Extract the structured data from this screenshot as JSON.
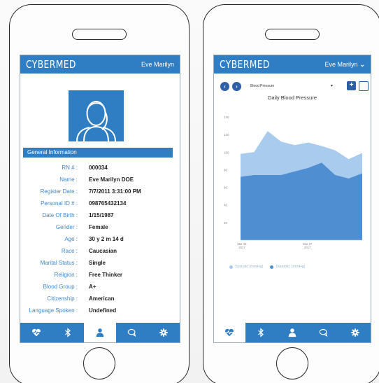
{
  "left_screen": {
    "app_title": "CYBERMED",
    "user_name": "Eve Marilyn",
    "section_title": "General Information",
    "rows": [
      {
        "label": "RN # :",
        "value": "000034"
      },
      {
        "label": "Name :",
        "value": "Eve Marilyn DOE"
      },
      {
        "label": "Register Date :",
        "value": "7/7/2011  3:31:00 PM"
      },
      {
        "label": "Personal ID # :",
        "value": "098765432134"
      },
      {
        "label": "Date Of Birth :",
        "value": "1/15/1987"
      },
      {
        "label": "Gender :",
        "value": "Female"
      },
      {
        "label": "Age :",
        "value": "30 y 2 m 14 d"
      },
      {
        "label": "Race :",
        "value": "Caucasian"
      },
      {
        "label": "Marital Status :",
        "value": "Single"
      },
      {
        "label": "Religion :",
        "value": "Free Thinker"
      },
      {
        "label": "Blood Group :",
        "value": "A+"
      },
      {
        "label": "Citizenship :",
        "value": "American"
      },
      {
        "label": "Language Spoken :",
        "value": "Undefined"
      }
    ],
    "tabs": [
      "heartbeat-icon",
      "bluetooth-icon",
      "user-icon",
      "chat-icon",
      "gear-icon"
    ],
    "active_tab": 2
  },
  "right_screen": {
    "app_title": "CYBERMED",
    "user_name": "Eve Marilyn",
    "selector_value": "Blood Pressure",
    "tabs": [
      "heartbeat-icon",
      "bluetooth-icon",
      "user-icon",
      "chat-icon",
      "gear-icon"
    ],
    "active_tab": 0
  },
  "colors": {
    "brand": "#2f7ec4",
    "systolic": "#a9cbed",
    "diastolic": "#4f8fd1"
  },
  "chart_data": {
    "type": "area",
    "title": "Daily Blood Pressure",
    "y_ticks": [
      "140",
      "120",
      "100",
      "80",
      "60",
      "40",
      "20"
    ],
    "ylim": [
      0,
      140
    ],
    "x_tick_labels": [
      [
        "Mar 26",
        "2017"
      ],
      [
        "Mar 27",
        "2017"
      ]
    ],
    "series": [
      {
        "name": "Systolic (mmHg)",
        "color": "#a9cbed",
        "values": [
          98,
          100,
          124,
          112,
          108,
          111,
          107,
          102,
          92,
          99
        ]
      },
      {
        "name": "Diastolic (mmHg)",
        "color": "#4f8fd1",
        "values": [
          72,
          74,
          74,
          74,
          78,
          82,
          88,
          74,
          70,
          76
        ]
      }
    ],
    "legend_position": "bottom",
    "grid": false
  }
}
